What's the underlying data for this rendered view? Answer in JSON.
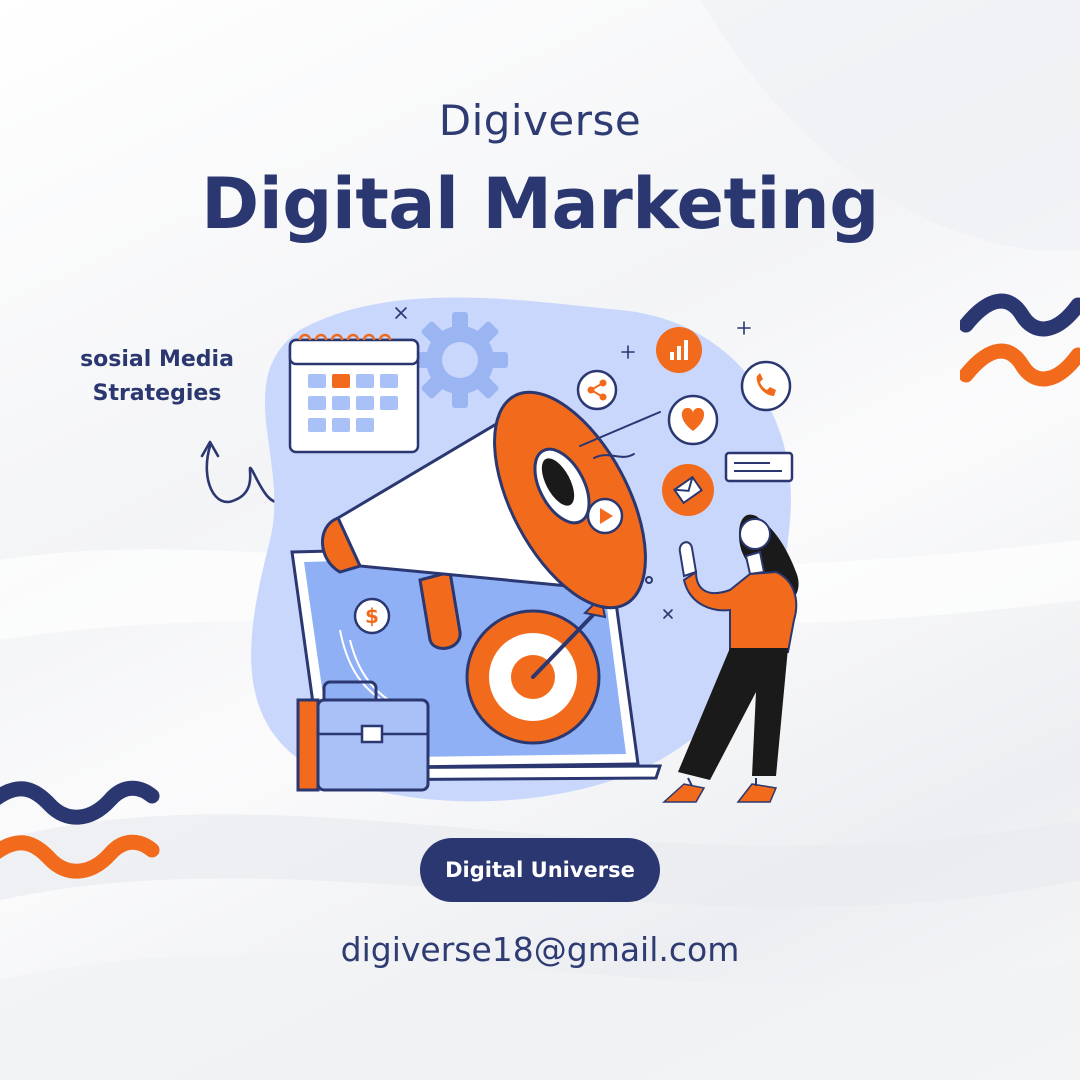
{
  "header": {
    "brand": "Digiverse",
    "headline": "Digital Marketing"
  },
  "tagline": "sosial Media\nStrategies",
  "cta": {
    "label": "Digital Universe"
  },
  "contact": {
    "email": "digiverse18@gmail.com"
  },
  "colors": {
    "navy": "#2b3770",
    "orange": "#f26a1b",
    "light_blue": "#c8d7fb",
    "mid_blue": "#8fb0f5",
    "background": "#f4f5f7"
  },
  "icons": [
    "calendar-icon",
    "gear-icon",
    "megaphone-icon",
    "share-icon",
    "bar-chart-icon",
    "phone-icon",
    "heart-icon",
    "message-icon",
    "mail-icon",
    "play-icon",
    "dollar-icon",
    "target-icon",
    "briefcase-icon",
    "laptop-icon",
    "person-illustration"
  ]
}
